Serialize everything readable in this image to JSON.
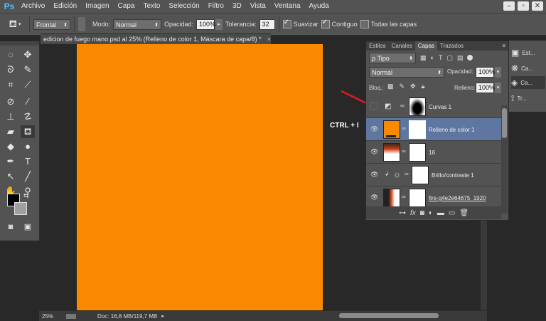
{
  "app": {
    "logo": "Ps"
  },
  "menu": [
    "Archivo",
    "Edición",
    "Imagen",
    "Capa",
    "Texto",
    "Selección",
    "Filtro",
    "3D",
    "Vista",
    "Ventana",
    "Ayuda"
  ],
  "window_controls": {
    "minimize": "–",
    "restore": "▫",
    "close": "✕"
  },
  "options": {
    "source_value": "Frontal",
    "mode_label": "Modo:",
    "mode_value": "Normal",
    "opacity_label": "Opacidad:",
    "opacity_value": "100%",
    "tolerance_label": "Tolerancia:",
    "tolerance_value": "32",
    "smooth_label": "Suavizar",
    "smooth_checked": true,
    "contiguous_label": "Contiguo",
    "contiguous_checked": true,
    "all_layers_label": "Todas las capas",
    "all_layers_checked": false
  },
  "document": {
    "tab_title": "edicion de fuego mano.psd al 25% (Relleno de color 1, Máscara de capa/8) *",
    "close": "×",
    "canvas_color": "#f98a00"
  },
  "status": {
    "zoom": "25%",
    "doc_info": "Doc: 16,8 MB/119,7 MB"
  },
  "annotation": {
    "text": "CTRL + I",
    "arrow_color": "#e0191b"
  },
  "panel": {
    "tabs": [
      "Estilos",
      "Canales",
      "Capas",
      "Trazados"
    ],
    "active_tab": "Capas",
    "filter_kind": "ρ Tipo",
    "blend_mode": "Normal",
    "opacity_label": "Opacidad:",
    "opacity_value": "100%",
    "lock_label": "Bloq.:",
    "fill_label": "Relleno:",
    "fill_value": "100%",
    "layers": [
      {
        "name": "Curvas 1",
        "visible": false,
        "selected": false
      },
      {
        "name": "Relleno de color 1",
        "visible": true,
        "selected": true
      },
      {
        "name": "16",
        "visible": true,
        "selected": false
      },
      {
        "name": "Brillo/contraste 1",
        "visible": true,
        "selected": false
      },
      {
        "name": "fire-g4e2e64675_1920",
        "visible": true,
        "selected": false
      }
    ]
  },
  "dock": [
    "Est...",
    "Ca...",
    "Ca...",
    "Tr..."
  ]
}
